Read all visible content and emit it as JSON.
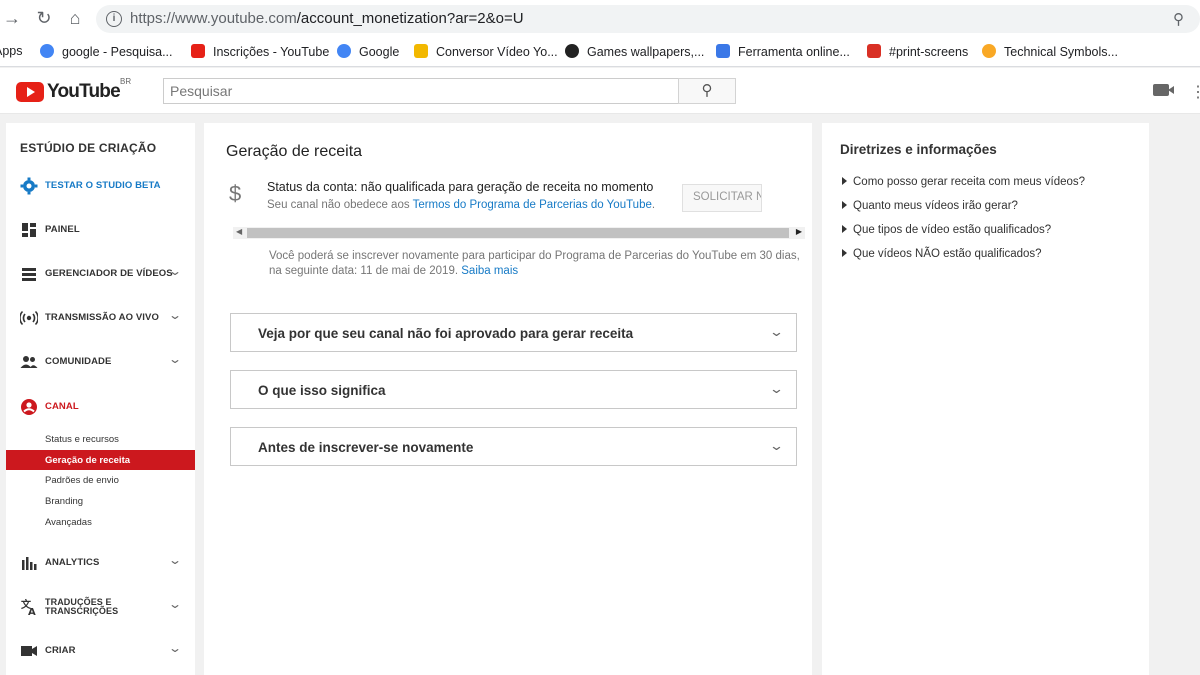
{
  "browser": {
    "url_prefix": "https://www.youtube.com",
    "url_path": "/account_monetization?ar=2&o=U",
    "bookmarks": [
      {
        "label": "Apps",
        "color": "#1a73e8"
      },
      {
        "label": "google - Pesquisa...",
        "color": "#4285f4"
      },
      {
        "label": "Inscrições - YouTube",
        "color": "#e62117"
      },
      {
        "label": "Google",
        "color": "#4285f4"
      },
      {
        "label": "Conversor Vídeo Yo...",
        "color": "#f2b800"
      },
      {
        "label": "Games wallpapers,...",
        "color": "#222222"
      },
      {
        "label": "Ferramenta online...",
        "color": "#3b78e7"
      },
      {
        "label": "#print-screens",
        "color": "#d93025"
      },
      {
        "label": "Technical Symbols...",
        "color": "#f9a825"
      }
    ]
  },
  "header": {
    "logo_text": "YouTube",
    "country_code": "BR",
    "search_placeholder": "Pesquisar"
  },
  "sidebar": {
    "title": "ESTÚDIO DE CRIAÇÃO",
    "items": [
      {
        "label": "TESTAR O STUDIO BETA",
        "icon": "gear-icon"
      },
      {
        "label": "PAINEL",
        "icon": "dashboard-icon"
      },
      {
        "label": "GERENCIADOR DE VÍDEOS",
        "icon": "video-manager-icon"
      },
      {
        "label": "TRANSMISSÃO AO VIVO",
        "icon": "live-icon"
      },
      {
        "label": "COMUNIDADE",
        "icon": "community-icon"
      },
      {
        "label": "CANAL",
        "icon": "channel-icon"
      },
      {
        "label": "ANALYTICS",
        "icon": "analytics-icon"
      },
      {
        "label": "TRADUÇÕES E TRANSCRIÇÕES",
        "icon": "translate-icon"
      },
      {
        "label": "CRIAR",
        "icon": "create-icon"
      }
    ],
    "channel_sub": [
      "Status e recursos",
      "Geração de receita",
      "Padrões de envio",
      "Branding",
      "Avançadas"
    ],
    "accent": "#cc181e"
  },
  "main": {
    "title": "Geração de receita",
    "status_label": "Status da conta: não qualificada para geração de receita no momento",
    "status_sub_prefix": "Seu canal não obedece aos ",
    "status_sub_link": "Termos do Programa de Parcerias do YouTube",
    "status_sub_suffix": ".",
    "request_button": "SOLICITAR NOVAMENTE",
    "reapply_text": "Você poderá se inscrever novamente para participar do Programa de Parcerias do YouTube em 30 dias, na seguinte data: 11 de mai de 2019.",
    "reapply_link": "Saiba mais",
    "accordions": [
      "Veja por que seu canal não foi aprovado para gerar receita",
      "O que isso significa",
      "Antes de inscrever-se novamente"
    ]
  },
  "right": {
    "title": "Diretrizes e informações",
    "faqs": [
      "Como posso gerar receita com meus vídeos?",
      "Quanto meus vídeos irão gerar?",
      "Que tipos de vídeo estão qualificados?",
      "Que vídeos NÃO estão qualificados?"
    ]
  }
}
